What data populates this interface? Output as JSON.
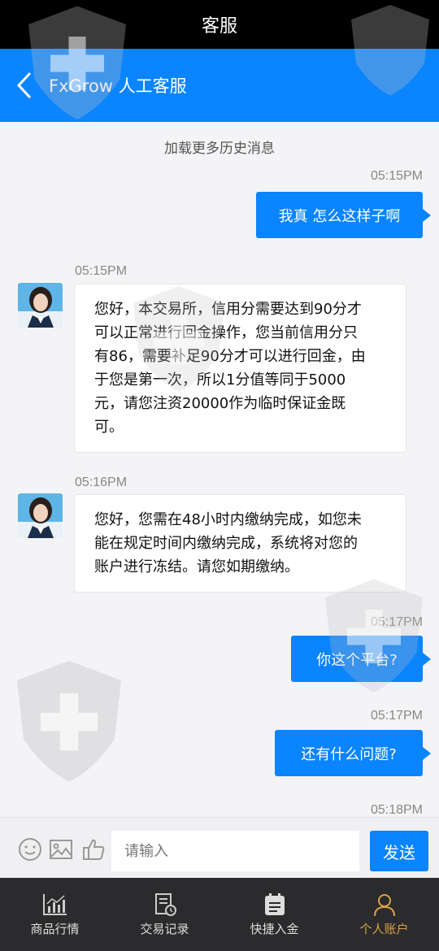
{
  "status_title": "客服",
  "nav": {
    "title": "FxGrow 人工客服",
    "back_icon": "chevron-left-icon"
  },
  "chat": {
    "load_more": "加载更多历史消息",
    "messages": [
      {
        "time": "05:15PM",
        "dir": "out",
        "text": "我真 怎么这样子啊"
      },
      {
        "time": "05:15PM",
        "dir": "in",
        "lines": [
          "您好，本交易所，信用分需要达到90分才",
          "可以正常进行回金操作，您当前信用分只",
          "有86，需要补足90分才可以进行回金，由",
          "于您是第一次，所以1分值等同于5000",
          "元，请您注资20000作为临时保证金既",
          "可。"
        ]
      },
      {
        "time": "05:16PM",
        "dir": "in",
        "lines": [
          "您好，您需在48小时内缴纳完成，如您未",
          "能在规定时间内缴纳完成，系统将对您的",
          "账户进行冻结。请您如期缴纳。"
        ]
      },
      {
        "time": "05:17PM",
        "dir": "out",
        "text": "你这个平台?"
      },
      {
        "time": "05:17PM",
        "dir": "out",
        "text": "还有什么问题?"
      },
      {
        "time": "05:18PM"
      }
    ]
  },
  "input": {
    "placeholder": "请输入",
    "send_label": "发送",
    "icons": [
      "emoji-icon",
      "image-icon",
      "thumbs-up-icon"
    ]
  },
  "tabs": [
    {
      "label": "商品行情",
      "icon": "chart-icon",
      "active": false
    },
    {
      "label": "交易记录",
      "icon": "record-icon",
      "active": false
    },
    {
      "label": "快捷入金",
      "icon": "deposit-icon",
      "active": false
    },
    {
      "label": "个人账户",
      "icon": "user-icon",
      "active": true
    }
  ],
  "colors": {
    "accent": "#0a84ff",
    "active_tab": "#d9a24a",
    "tabbar": "#2b2b2d"
  }
}
